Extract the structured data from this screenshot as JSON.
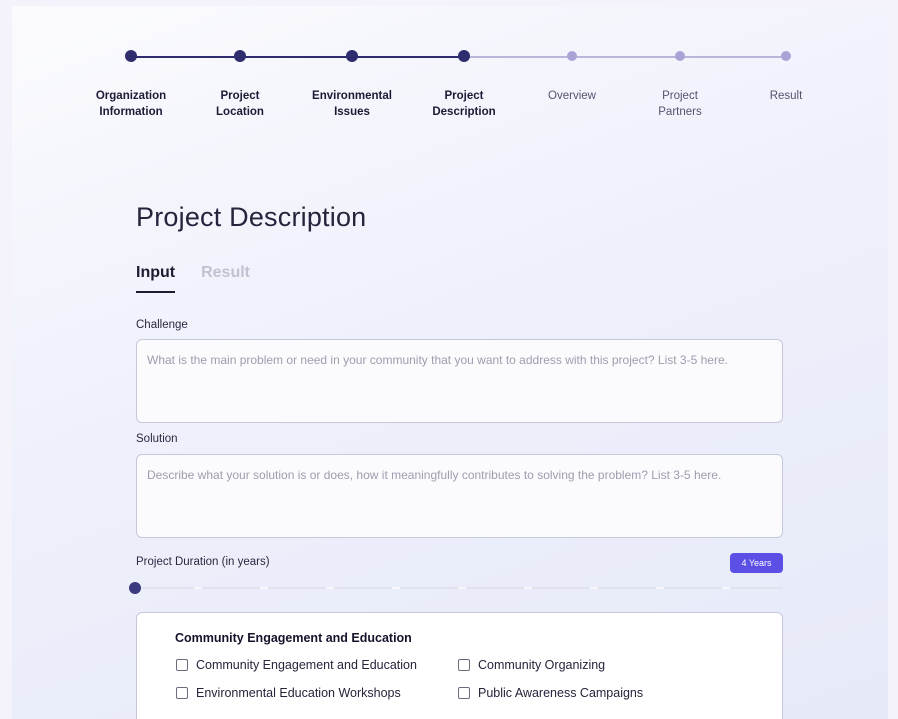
{
  "stepper": {
    "steps": [
      {
        "label": "Organization\nInformation",
        "state": "done"
      },
      {
        "label": "Project\nLocation",
        "state": "done"
      },
      {
        "label": "Environmental\nIssues",
        "state": "done"
      },
      {
        "label": "Project\nDescription",
        "state": "current"
      },
      {
        "label": "Overview",
        "state": "pending"
      },
      {
        "label": "Project\nPartners",
        "state": "pending"
      },
      {
        "label": "Result",
        "state": "pending"
      }
    ]
  },
  "page": {
    "title": "Project Description",
    "tabs": [
      {
        "label": "Input",
        "active": true
      },
      {
        "label": "Result",
        "active": false
      }
    ]
  },
  "form": {
    "challenge": {
      "label": "Challenge",
      "value": "",
      "placeholder": "What is the main problem or need in your community that you want to address with this project? List 3-5 here."
    },
    "solution": {
      "label": "Solution",
      "value": "",
      "placeholder": "Describe what your solution is or does, how it meaningfully contributes to solving the problem? List 3-5 here."
    },
    "duration": {
      "label": "Project Duration (in years)",
      "badge": "4 Years",
      "value_fraction": 0
    }
  },
  "categories": {
    "heading": "Community Engagement and Education",
    "options": [
      {
        "label": "Community Engagement and Education",
        "checked": false
      },
      {
        "label": "Community Organizing",
        "checked": false
      },
      {
        "label": "Environmental Education Workshops",
        "checked": false
      },
      {
        "label": "Public Awareness Campaigns",
        "checked": false
      }
    ]
  },
  "colors": {
    "accent": "#5b4fe6",
    "step_done": "#2f2d6e",
    "step_pending": "#a8a4d6"
  }
}
